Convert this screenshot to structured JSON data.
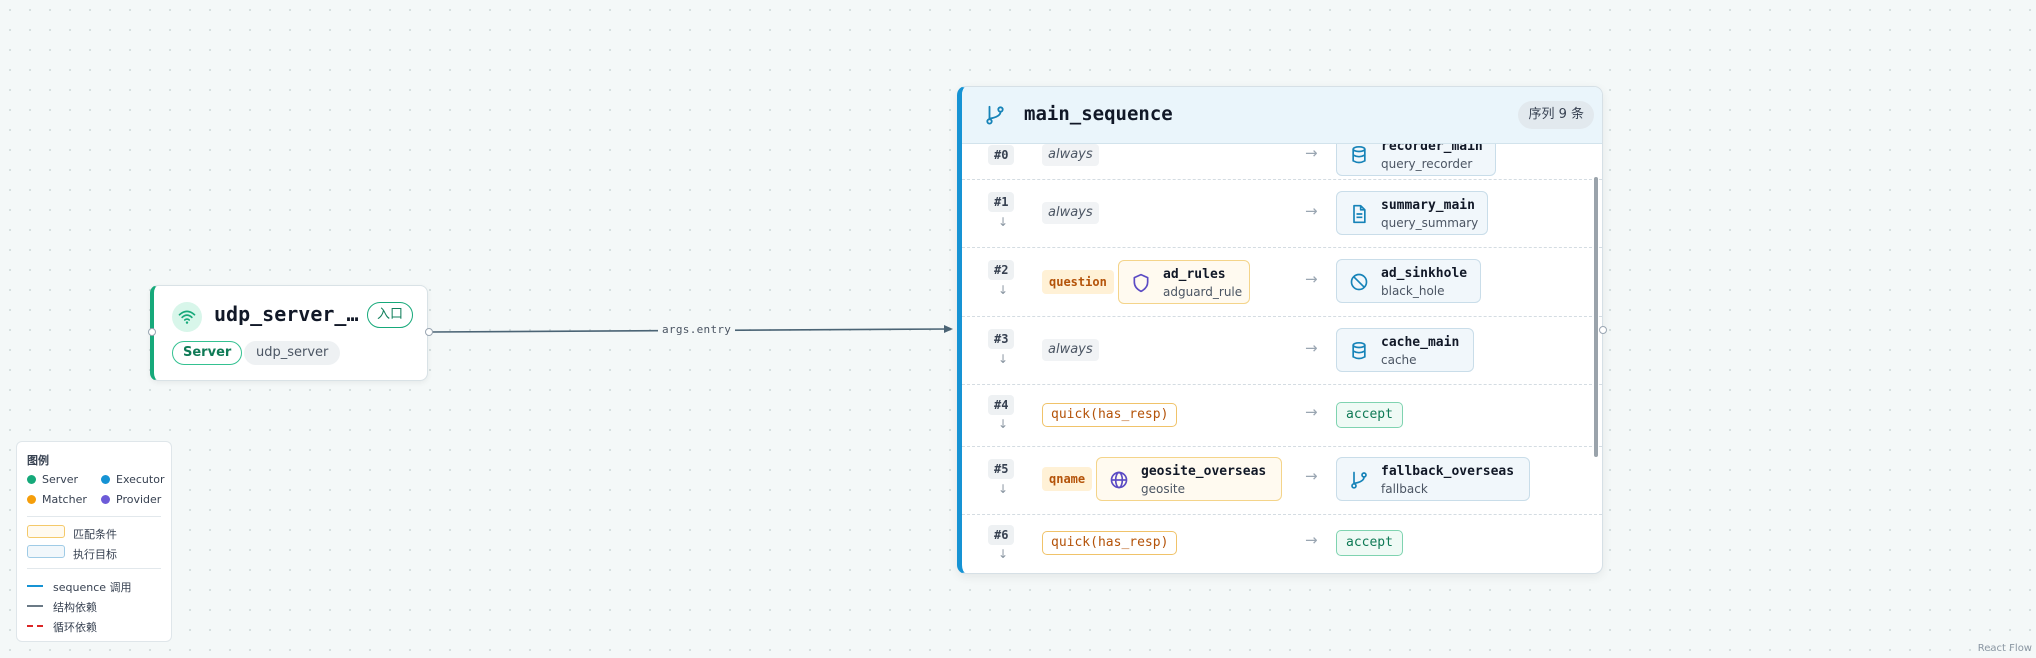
{
  "server": {
    "title": "udp_server_…",
    "entry_badge": "入口",
    "type_label": "Server",
    "name": "udp_server"
  },
  "edge": {
    "label": "args.entry"
  },
  "sequence": {
    "title": "main_sequence",
    "count": "序列 9 条",
    "rows": [
      {
        "index": "#0",
        "condition": "always",
        "exec_name": "recorder_main",
        "exec_sub": "query_recorder"
      },
      {
        "index": "#1",
        "condition": "always",
        "exec_name": "summary_main",
        "exec_sub": "query_summary"
      },
      {
        "index": "#2",
        "cond_tag": "question",
        "matcher_name": "ad_rules",
        "matcher_sub": "adguard_rule",
        "exec_name": "ad_sinkhole",
        "exec_sub": "black_hole"
      },
      {
        "index": "#3",
        "condition": "always",
        "exec_name": "cache_main",
        "exec_sub": "cache"
      },
      {
        "index": "#4",
        "quick": "quick(has_resp)",
        "accept": "accept"
      },
      {
        "index": "#5",
        "cond_tag": "qname",
        "matcher_name": "geosite_overseas",
        "matcher_sub": "geosite",
        "exec_name": "fallback_overseas",
        "exec_sub": "fallback"
      },
      {
        "index": "#6",
        "quick": "quick(has_resp)",
        "accept": "accept"
      }
    ]
  },
  "legend": {
    "title": "图例",
    "server": "Server",
    "executor": "Executor",
    "matcher": "Matcher",
    "provider": "Provider",
    "match_condition": "匹配条件",
    "exec_target": "执行目标",
    "sequence_call": "sequence 调用",
    "struct_dep": "结构依赖",
    "cycle_dep": "循环依赖"
  },
  "colors": {
    "server": "#16a97a",
    "executor": "#1693d4",
    "matcher": "#f59e0b",
    "provider": "#6d5bd8",
    "cycle": "#dc2626"
  },
  "attribution": "React Flow"
}
